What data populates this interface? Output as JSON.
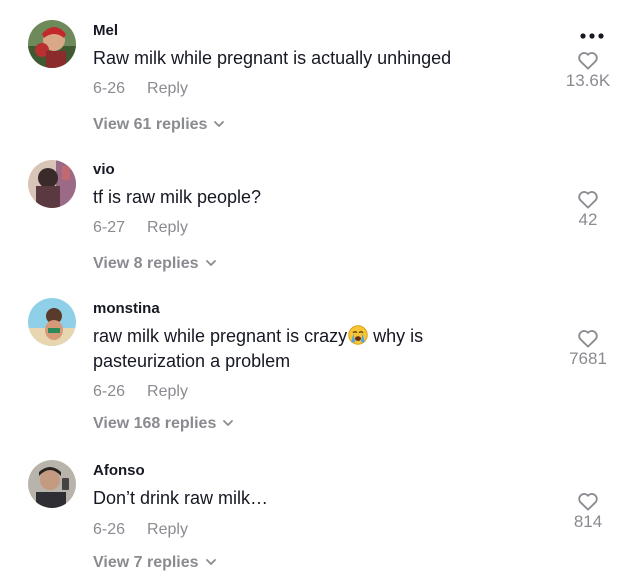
{
  "comments": [
    {
      "username": "Mel",
      "text": "Raw milk while pregnant is actually unhinged",
      "date": "6-26",
      "reply_label": "Reply",
      "likes": "13.6K",
      "view_replies": "View 61 replies"
    },
    {
      "username": "vio",
      "text": "tf is raw milk people?",
      "date": "6-27",
      "reply_label": "Reply",
      "likes": "42",
      "view_replies": "View 8 replies"
    },
    {
      "username": "monstina",
      "text_before_emoji": "raw milk while pregnant is crazy",
      "text_after_emoji": " why is pasteurization a problem",
      "emoji": "loudly-crying-face-emoji",
      "date": "6-26",
      "reply_label": "Reply",
      "likes": "7681",
      "view_replies": "View 168 replies"
    },
    {
      "username": "Afonso",
      "text": "Don’t drink raw milk…",
      "date": "6-26",
      "reply_label": "Reply",
      "likes": "814",
      "view_replies": "View 7 replies"
    }
  ],
  "icons": {
    "more": "more-options-icon",
    "like": "heart-outline-icon",
    "expand": "chevron-down-icon"
  },
  "colors": {
    "text": "#161823",
    "secondary": "#8a8b91"
  }
}
